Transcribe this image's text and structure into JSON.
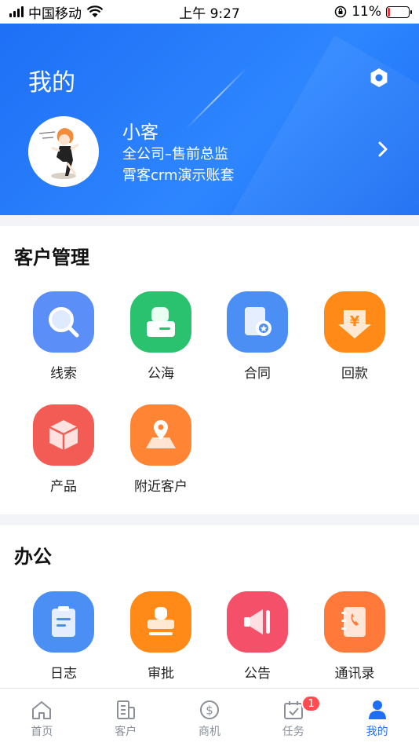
{
  "status_bar": {
    "carrier": "中国移动",
    "time": "上午 9:27",
    "battery": "11%"
  },
  "header": {
    "title": "我的",
    "user": {
      "name": "小客",
      "department": "全公司–售前总监",
      "account": "霄客crm演示账套"
    }
  },
  "sections": {
    "customer": {
      "title": "客户管理",
      "items": [
        {
          "label": "线索",
          "color": "#5b8ef7",
          "icon": "search-icon"
        },
        {
          "label": "公海",
          "color": "#2bc26f",
          "icon": "contact-card-icon"
        },
        {
          "label": "合同",
          "color": "#4b8ff5",
          "icon": "contract-icon"
        },
        {
          "label": "回款",
          "color": "#ff8a18",
          "icon": "payment-icon"
        },
        {
          "label": "产品",
          "color": "#f25c54",
          "icon": "product-box-icon"
        },
        {
          "label": "附近客户",
          "color": "#ff8535",
          "icon": "map-pin-icon"
        }
      ]
    },
    "office": {
      "title": "办公",
      "items": [
        {
          "label": "日志",
          "color": "#4b8ff5",
          "icon": "log-icon"
        },
        {
          "label": "审批",
          "color": "#ff8a18",
          "icon": "stamp-icon"
        },
        {
          "label": "公告",
          "color": "#f5506a",
          "icon": "announcement-icon"
        },
        {
          "label": "通讯录",
          "color": "#ff7a3a",
          "icon": "address-book-icon"
        }
      ]
    }
  },
  "tab_bar": {
    "tabs": [
      {
        "label": "首页",
        "icon": "home-icon"
      },
      {
        "label": "客户",
        "icon": "customer-icon"
      },
      {
        "label": "商机",
        "icon": "opportunity-icon"
      },
      {
        "label": "任务",
        "icon": "task-icon",
        "badge": "1"
      },
      {
        "label": "我的",
        "icon": "profile-icon",
        "active": true
      }
    ]
  },
  "colors": {
    "brand": "#1e6ff5",
    "badge": "#ff4d4f"
  }
}
